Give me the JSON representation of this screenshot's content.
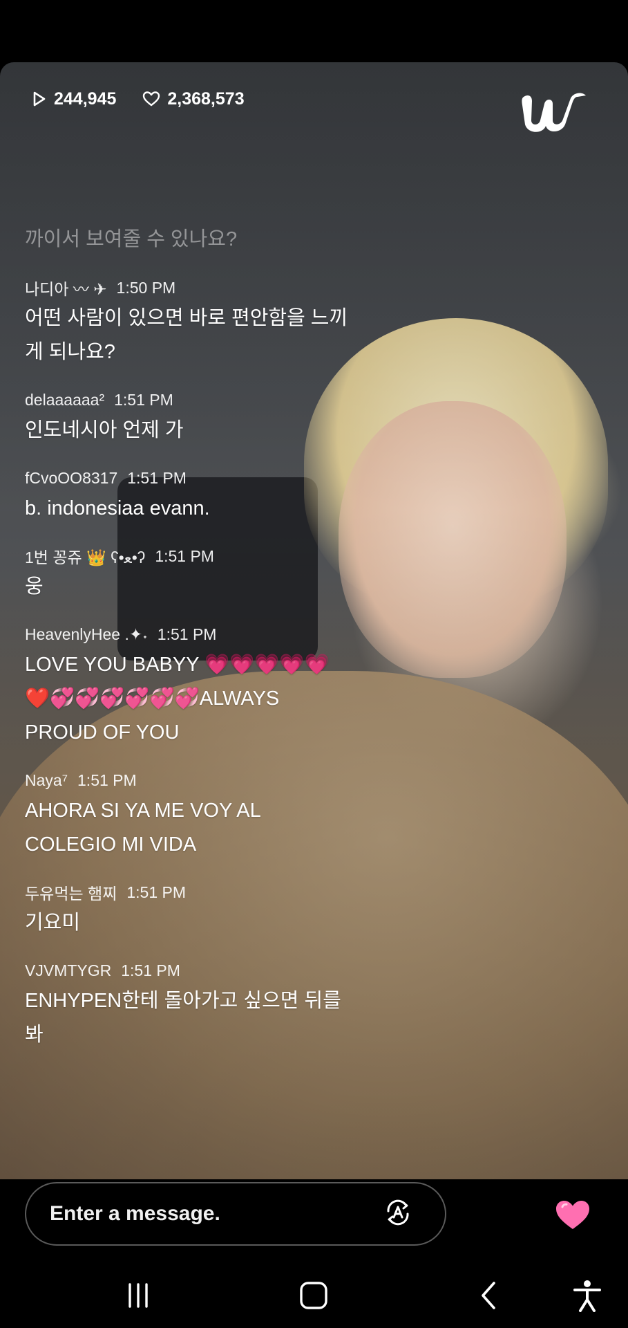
{
  "stats": {
    "plays": "244,945",
    "likes": "2,368,573"
  },
  "faded_comment": "까이서 보여줄 수 있나요?",
  "messages": [
    {
      "user": "나디아 〰 ✈",
      "time": "1:50 PM",
      "text": "어떤 사람이 있으면 바로 편안함을 느끼게 되나요?"
    },
    {
      "user": "delaaaaaa²",
      "time": "1:51 PM",
      "text": "인도네시아 언제 가"
    },
    {
      "user": "fCvoOO8317",
      "time": "1:51 PM",
      "text": "b. indonesiaa evann."
    },
    {
      "user": "1번 꽁쥬 👑 ʕ•ﻌ•ʔ",
      "time": "1:51 PM",
      "text": "웅"
    },
    {
      "user": "HeavenlyHee .✦˖",
      "time": "1:51 PM",
      "text": "LOVE YOU BABYY 💗💗💗💗💗 ❤️💞💞💞💞💞💞ALWAYS PROUD OF YOU"
    },
    {
      "user": "Naya⁷",
      "time": "1:51 PM",
      "text": "AHORA SI YA ME VOY AL COLEGIO MI VIDA"
    },
    {
      "user": "두유먹는 햄찌",
      "time": "1:51 PM",
      "text": "기요미"
    },
    {
      "user": "VJVMTYGR",
      "time": "1:51 PM",
      "text": "ENHYPEN한테 돌아가고 싶으면 뒤를 봐"
    }
  ],
  "input": {
    "placeholder": "Enter a message."
  },
  "colors": {
    "heart": "#ff6fb1",
    "background": "#000000"
  },
  "icons": {
    "play": "play-icon",
    "like": "heart-outline-icon",
    "logo": "weverse-logo",
    "translate": "translate-icon",
    "send_heart": "heart-icon",
    "nav_recent": "recent-apps-icon",
    "nav_home": "home-icon",
    "nav_back": "back-icon",
    "nav_accessibility": "accessibility-icon"
  }
}
